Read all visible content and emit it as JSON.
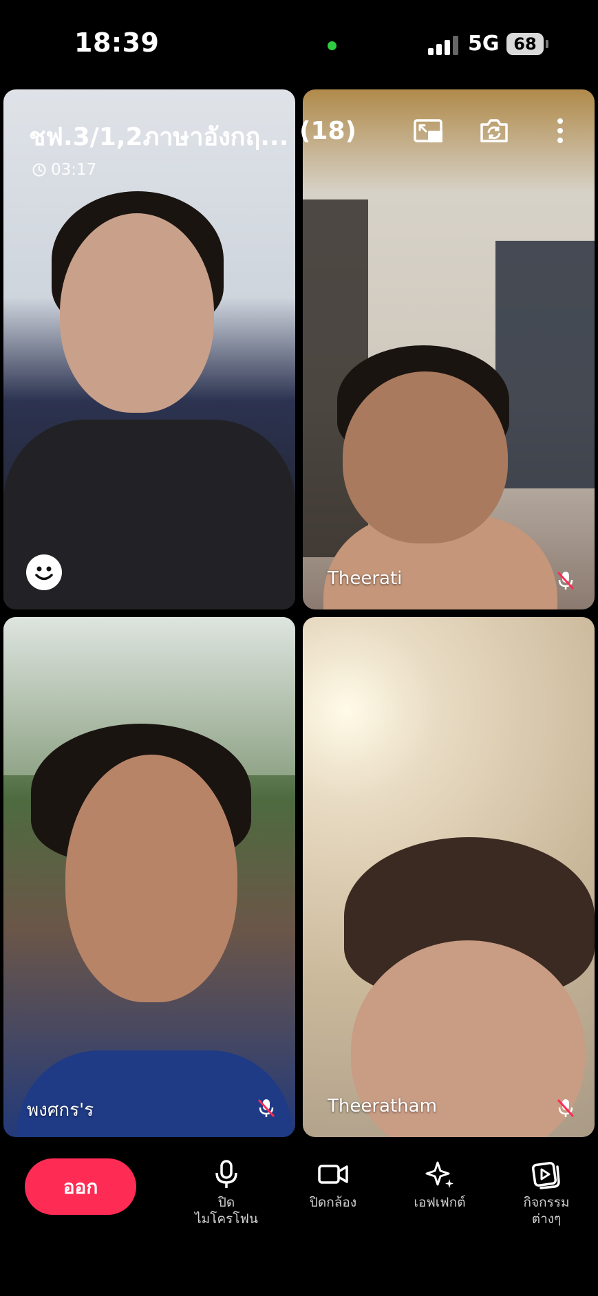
{
  "status_bar": {
    "time": "18:39",
    "network": "5G",
    "battery": "68"
  },
  "call": {
    "title": "ชฟ.3/1,2ภาษาอังกฤ...",
    "participant_count": "(18)",
    "duration": "03:17"
  },
  "participants": [
    {
      "name": ""
    },
    {
      "name": "Theerati"
    },
    {
      "name": "พงศกร'ร"
    },
    {
      "name": "Theeratham"
    }
  ],
  "controls": {
    "leave": "ออก",
    "mic_line1": "ปิด",
    "mic_line2": "ไมโครโฟน",
    "camera": "ปิดกล้อง",
    "effects": "เอฟเฟกต์",
    "activities_line1": "กิจกรรม",
    "activities_line2": "ต่างๆ"
  },
  "icons": {
    "pip": "picture-in-picture-icon",
    "flip": "flip-camera-icon",
    "more": "more-vertical-icon",
    "emoji": "emoji-icon",
    "mic": "microphone-icon",
    "video": "video-camera-icon",
    "effects": "sparkle-icon",
    "activities": "activities-icon",
    "muted": "mic-off-icon"
  },
  "colors": {
    "leave_button": "#fe2c55",
    "background": "#000000",
    "muted_slash": "#fe2c55"
  }
}
